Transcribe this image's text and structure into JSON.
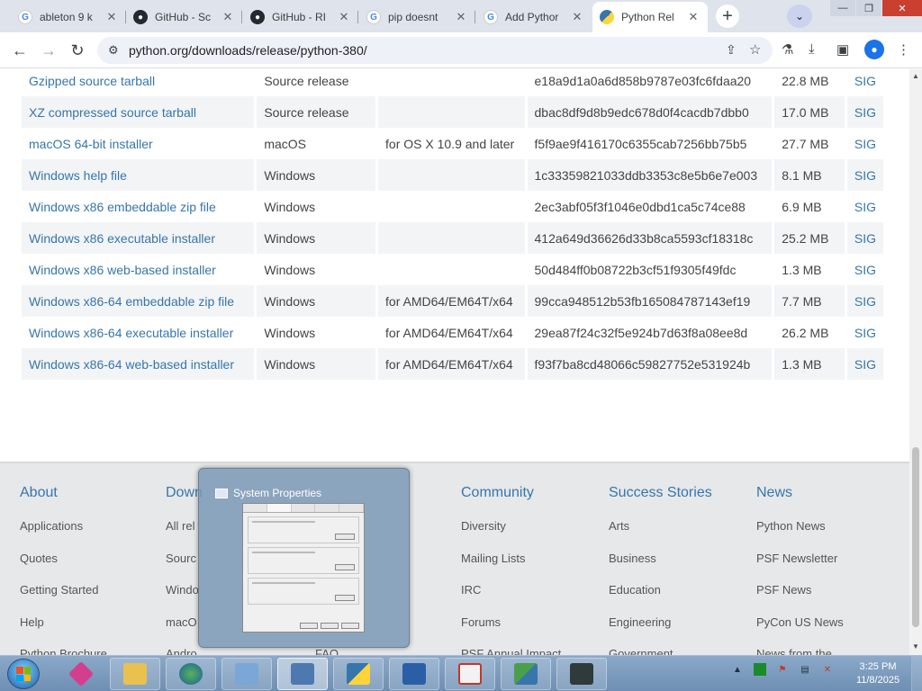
{
  "browser": {
    "tabs": [
      {
        "title": "ableton 9 k",
        "icon": "google-icon",
        "active": false
      },
      {
        "title": "GitHub - Sc",
        "icon": "github-icon",
        "active": false
      },
      {
        "title": "GitHub - RI",
        "icon": "github-icon",
        "active": false
      },
      {
        "title": "pip doesnt",
        "icon": "google-icon",
        "active": false
      },
      {
        "title": "Add Pythor",
        "icon": "google-icon",
        "active": false
      },
      {
        "title": "Python Rel",
        "icon": "python-icon",
        "active": true
      }
    ],
    "url": "python.org/downloads/release/python-380/"
  },
  "files": {
    "rows": [
      {
        "version": "Gzipped source tarball",
        "os": "Source release",
        "description": "",
        "md5": "e18a9d1a0a6d858b9787e03fc6fdaa20",
        "size": "22.8 MB",
        "sig": "SIG"
      },
      {
        "version": "XZ compressed source tarball",
        "os": "Source release",
        "description": "",
        "md5": "dbac8df9d8b9edc678d0f4cacdb7dbb0",
        "size": "17.0 MB",
        "sig": "SIG"
      },
      {
        "version": "macOS 64-bit installer",
        "os": "macOS",
        "description": "for OS X 10.9 and later",
        "md5": "f5f9ae9f416170c6355cab7256bb75b5",
        "size": "27.7 MB",
        "sig": "SIG"
      },
      {
        "version": "Windows help file",
        "os": "Windows",
        "description": "",
        "md5": "1c33359821033ddb3353c8e5b6e7e003",
        "size": "8.1 MB",
        "sig": "SIG"
      },
      {
        "version": "Windows x86 embeddable zip file",
        "os": "Windows",
        "description": "",
        "md5": "2ec3abf05f3f1046e0dbd1ca5c74ce88",
        "size": "6.9 MB",
        "sig": "SIG"
      },
      {
        "version": "Windows x86 executable installer",
        "os": "Windows",
        "description": "",
        "md5": "412a649d36626d33b8ca5593cf18318c",
        "size": "25.2 MB",
        "sig": "SIG"
      },
      {
        "version": "Windows x86 web-based installer",
        "os": "Windows",
        "description": "",
        "md5": "50d484ff0b08722b3cf51f9305f49fdc",
        "size": "1.3 MB",
        "sig": "SIG"
      },
      {
        "version": "Windows x86-64 embeddable zip file",
        "os": "Windows",
        "description": "for AMD64/EM64T/x64",
        "md5": "99cca948512b53fb165084787143ef19",
        "size": "7.7 MB",
        "sig": "SIG"
      },
      {
        "version": "Windows x86-64 executable installer",
        "os": "Windows",
        "description": "for AMD64/EM64T/x64",
        "md5": "29ea87f24c32f5e924b7d63f8a08ee8d",
        "size": "26.2 MB",
        "sig": "SIG"
      },
      {
        "version": "Windows x86-64 web-based installer",
        "os": "Windows",
        "description": "for AMD64/EM64T/x64",
        "md5": "f93f7ba8cd48066c59827752e531924b",
        "size": "1.3 MB",
        "sig": "SIG"
      }
    ]
  },
  "footer": {
    "about": {
      "heading": "About",
      "links": [
        "Applications",
        "Quotes",
        "Getting Started",
        "Help",
        "Python Brochure"
      ]
    },
    "downloads": {
      "heading": "Down",
      "links": [
        "All rel",
        "Sourc",
        "Windo",
        "macO",
        "Andro"
      ]
    },
    "docs": {
      "links": [
        "",
        "",
        "",
        "",
        "FAQ"
      ]
    },
    "community": {
      "heading": "Community",
      "links": [
        "Diversity",
        "Mailing Lists",
        "IRC",
        "Forums",
        "PSF Annual Impact"
      ]
    },
    "success": {
      "heading": "Success Stories",
      "links": [
        "Arts",
        "Business",
        "Education",
        "Engineering",
        "Government"
      ]
    },
    "news": {
      "heading": "News",
      "links": [
        "Python News",
        "PSF Newsletter",
        "PSF News",
        "PyCon US News",
        "News from the"
      ]
    }
  },
  "preview": {
    "title": "System Properties"
  },
  "taskbar": {
    "apps": [
      "pink-app-icon",
      "file-explorer-icon",
      "network-globe-icon",
      "control-panel-icon",
      "system-properties-icon",
      "python-icon",
      "powershell-icon",
      "snipping-tool-icon",
      "python-installer-icon",
      "terminal-icon"
    ],
    "time": "3:25 PM",
    "date": "11/8/2025"
  }
}
